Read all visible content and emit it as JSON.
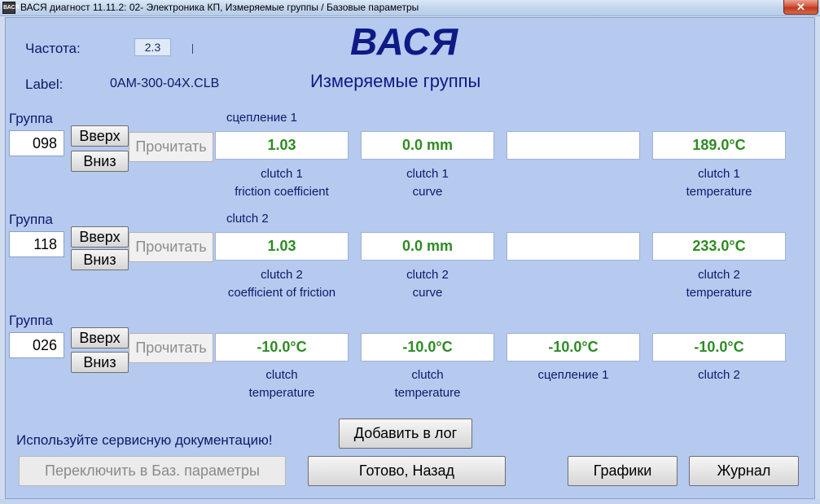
{
  "window": {
    "icon_text": "ВАСЯ",
    "title": "ВАСЯ диагност 11.11.2: 02- Электроника КП,  Измеряемые группы / Базовые параметры",
    "close_glyph": "✕"
  },
  "header": {
    "freq_label": "Частота:",
    "freq_value": "2.3",
    "label_label": "Label:",
    "label_value": "0AM-300-04X.CLB",
    "brand": "ВАСЯ",
    "subtitle": "Измеряемые группы"
  },
  "common": {
    "group_label": "Группа",
    "up_label": "Вверх",
    "down_label": "Вниз",
    "read_label": "Прочитать"
  },
  "groups": [
    {
      "number": "098",
      "name": "сцепление 1",
      "fields": [
        {
          "value": "1.03",
          "desc1": "clutch 1",
          "desc2": "friction coefficient"
        },
        {
          "value": "0.0 mm",
          "desc1": "clutch 1",
          "desc2": "curve"
        },
        {
          "value": "",
          "desc1": "",
          "desc2": ""
        },
        {
          "value": "189.0°C",
          "desc1": "clutch 1",
          "desc2": "temperature"
        }
      ]
    },
    {
      "number": "118",
      "name": "clutch 2",
      "fields": [
        {
          "value": "1.03",
          "desc1": "clutch 2",
          "desc2": "coefficient of friction"
        },
        {
          "value": "0.0 mm",
          "desc1": "clutch 2",
          "desc2": "curve"
        },
        {
          "value": "",
          "desc1": "",
          "desc2": ""
        },
        {
          "value": "233.0°C",
          "desc1": "clutch 2",
          "desc2": "temperature"
        }
      ]
    },
    {
      "number": "026",
      "name": "",
      "fields": [
        {
          "value": "-10.0°C",
          "desc1": "clutch",
          "desc2": "temperature"
        },
        {
          "value": "-10.0°C",
          "desc1": "clutch",
          "desc2": "temperature"
        },
        {
          "value": "-10.0°C",
          "desc1": "сцепление 1",
          "desc2": ""
        },
        {
          "value": "-10.0°C",
          "desc1": "clutch 2",
          "desc2": ""
        }
      ]
    }
  ],
  "footer": {
    "note": "Используйте сервисную документацию!",
    "add_log_label": "Добавить в лог",
    "switch_label": "Переключить в Баз. параметры",
    "done_label": "Готово, Назад",
    "graphs_label": "Графики",
    "journal_label": "Журнал"
  },
  "colors": {
    "background": "#b6c9ef",
    "value_text": "#2e8b23",
    "label_text": "#0c1a6b",
    "brand_text": "#0e1a86"
  }
}
